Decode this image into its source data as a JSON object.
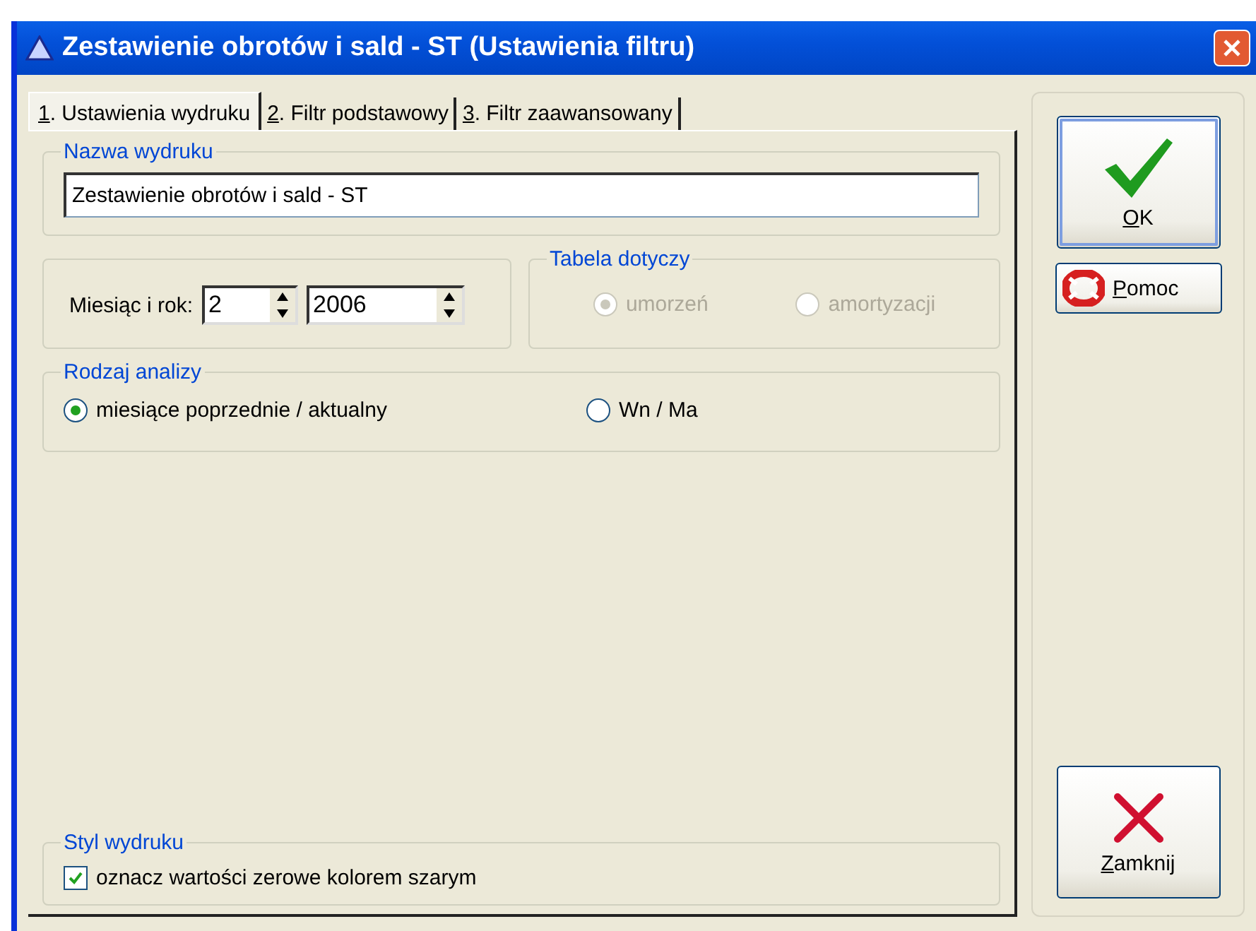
{
  "window": {
    "title": "Zestawienie obrotów i sald - ST (Ustawienia filtru)"
  },
  "tabs": [
    {
      "label": "1. Ustawienia wydruku",
      "selected": true
    },
    {
      "label": "2. Filtr podstawowy",
      "selected": false
    },
    {
      "label": "3. Filtr zaawansowany",
      "selected": false
    }
  ],
  "print_name": {
    "title": "Nazwa wydruku",
    "value": "Zestawienie obrotów i sald - ST"
  },
  "period": {
    "label": "Miesiąc i rok:",
    "month": "2",
    "year": "2006"
  },
  "table_scope": {
    "title": "Tabela dotyczy",
    "disabled": true,
    "options": [
      {
        "label": "umorzeń",
        "selected": true
      },
      {
        "label": "amortyzacji",
        "selected": false
      }
    ]
  },
  "analysis": {
    "title": "Rodzaj analizy",
    "options": [
      {
        "label": "miesiące poprzednie / aktualny",
        "selected": true
      },
      {
        "label": "Wn / Ma",
        "selected": false
      }
    ]
  },
  "style": {
    "title": "Styl wydruku",
    "checkbox": {
      "label": "oznacz wartości zerowe kolorem szarym",
      "checked": true
    }
  },
  "buttons": [
    {
      "kind": "ok",
      "label": "OK"
    },
    {
      "kind": "help",
      "label": "Pomoc"
    },
    {
      "kind": "close",
      "label": "Zamknij"
    }
  ]
}
